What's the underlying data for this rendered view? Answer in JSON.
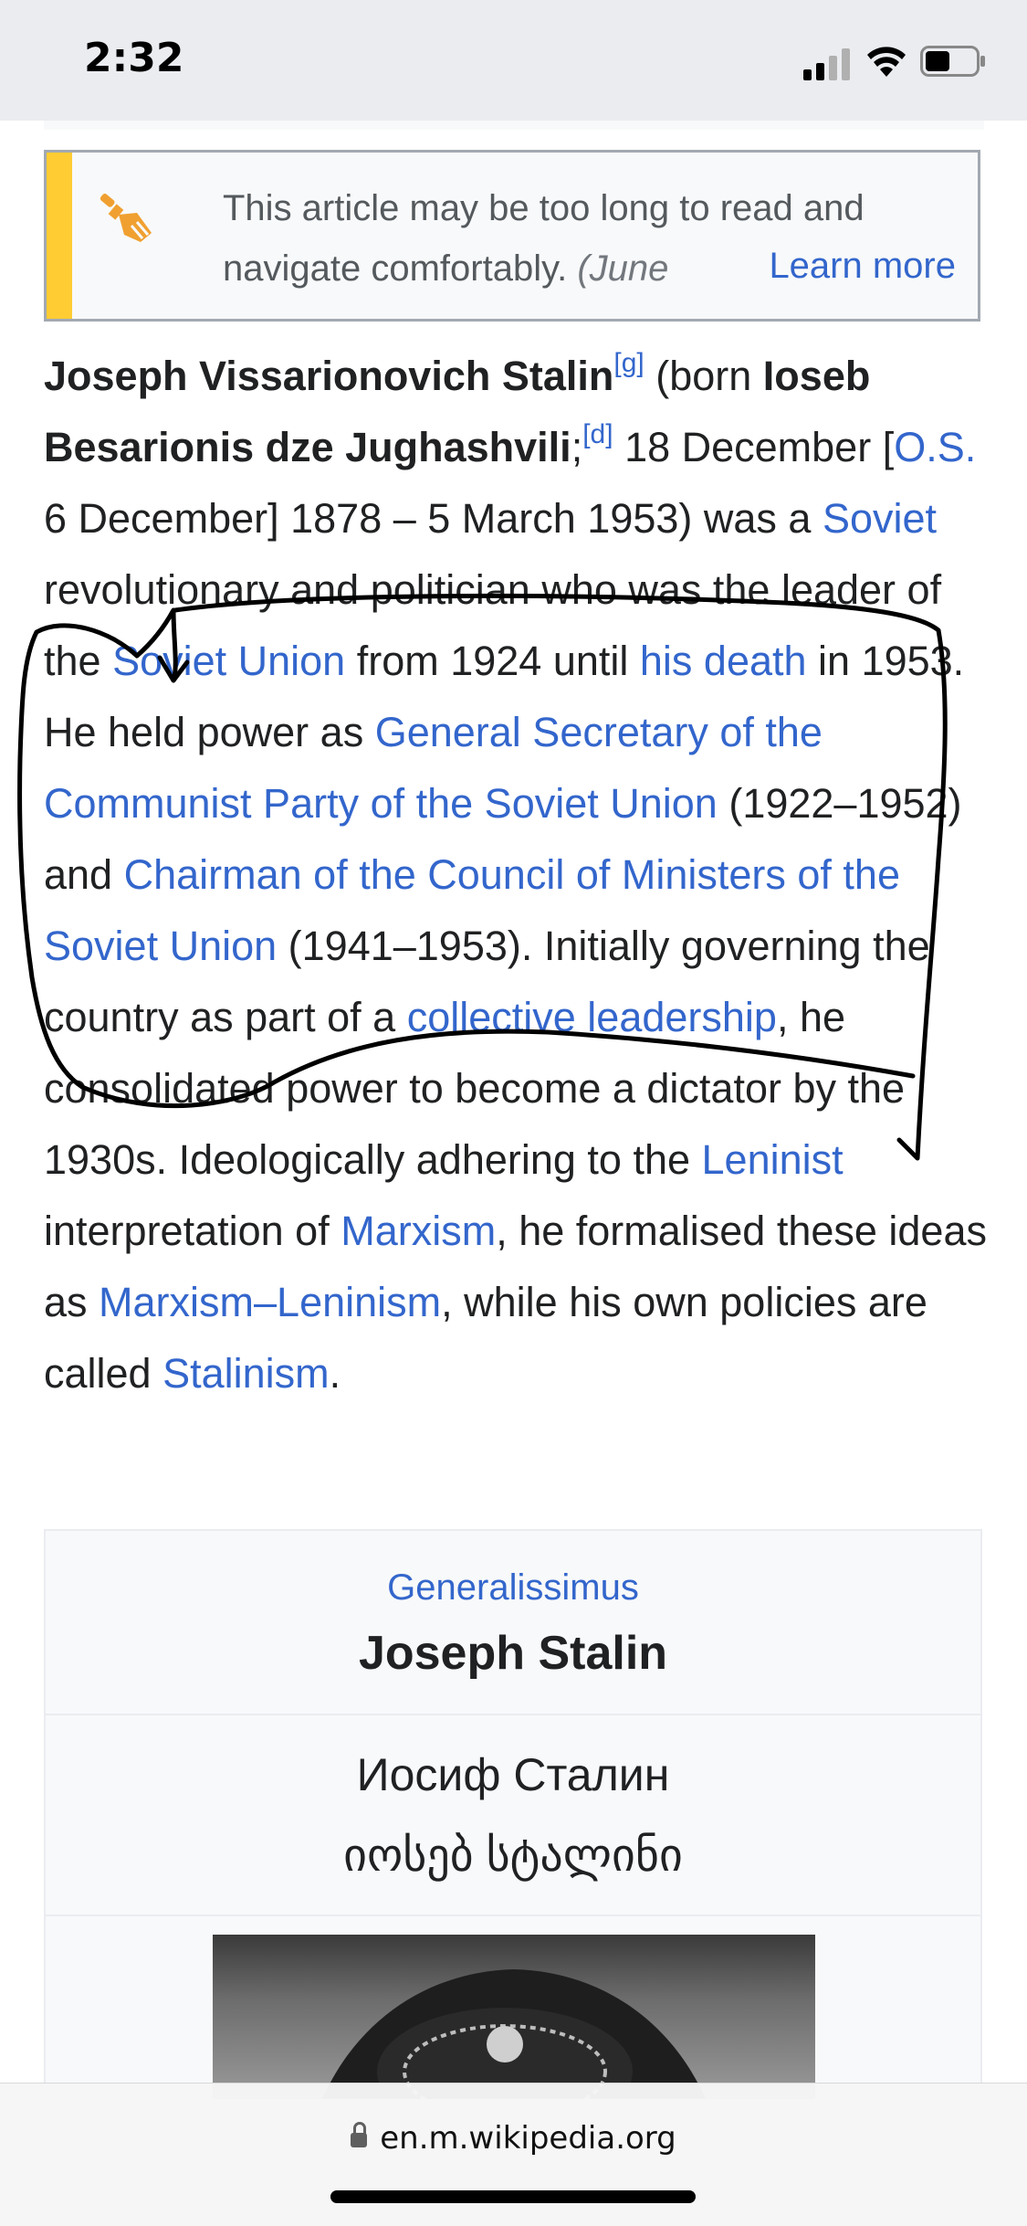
{
  "status_bar": {
    "time": "2:32"
  },
  "notice": {
    "line1": "This article may be too long to read and",
    "line2": "navigate comfortably.",
    "date": "(June",
    "learn_more": "Learn more"
  },
  "lead": {
    "name": "Joseph Vissarionovich Stalin",
    "note_g": "[g]",
    "born_prefix": " (born ",
    "native_name": "Ioseb Besarionis dze Jughashvili",
    "semicolon": ";",
    "note_d": "[d]",
    "date_part1": " 18 December [",
    "os_link": "O.S.",
    "date_part2": " 6 December] 1878 – 5 March 1953) was a ",
    "soviet_link": "Soviet",
    "text1": " revolutionary and politician who was the leader of the ",
    "soviet_union_link": "Soviet Union",
    "text2": " from 1924 until ",
    "his_death_link": "his death",
    "text3": " in 1953. He held power as ",
    "gen_sec_link": "General Secretary of the Communist Party of the Soviet Union",
    "text4": " (1922–1952) and ",
    "chairman_link": "Chairman of the Council of Ministers of the Soviet Union",
    "text5": " (1941–1953). Initially governing the country as part of a ",
    "collective_link": "collective leadership",
    "text6": ", he consolidated power to become a dictator by the 1930s. Ideologically adhering to the ",
    "leninist_link": "Leninist",
    "text7": " interpretation of ",
    "marxism_link": "Marxism",
    "text8": ", he formalised these ideas as ",
    "ml_link": "Marxism–Leninism",
    "text9": ", while his own policies are called ",
    "stalinism_link": "Stalinism",
    "text10": "."
  },
  "infobox": {
    "rank": "Generalissimus",
    "name": "Joseph Stalin",
    "native_russian": "Иосиф Сталин",
    "native_georgian": "იოსებ სტალინი"
  },
  "browser": {
    "url": "en.m.wikipedia.org"
  },
  "colors": {
    "link": "#3366cc",
    "notice_stripe": "#ffcc33",
    "broom_icon": "#f0a030"
  }
}
